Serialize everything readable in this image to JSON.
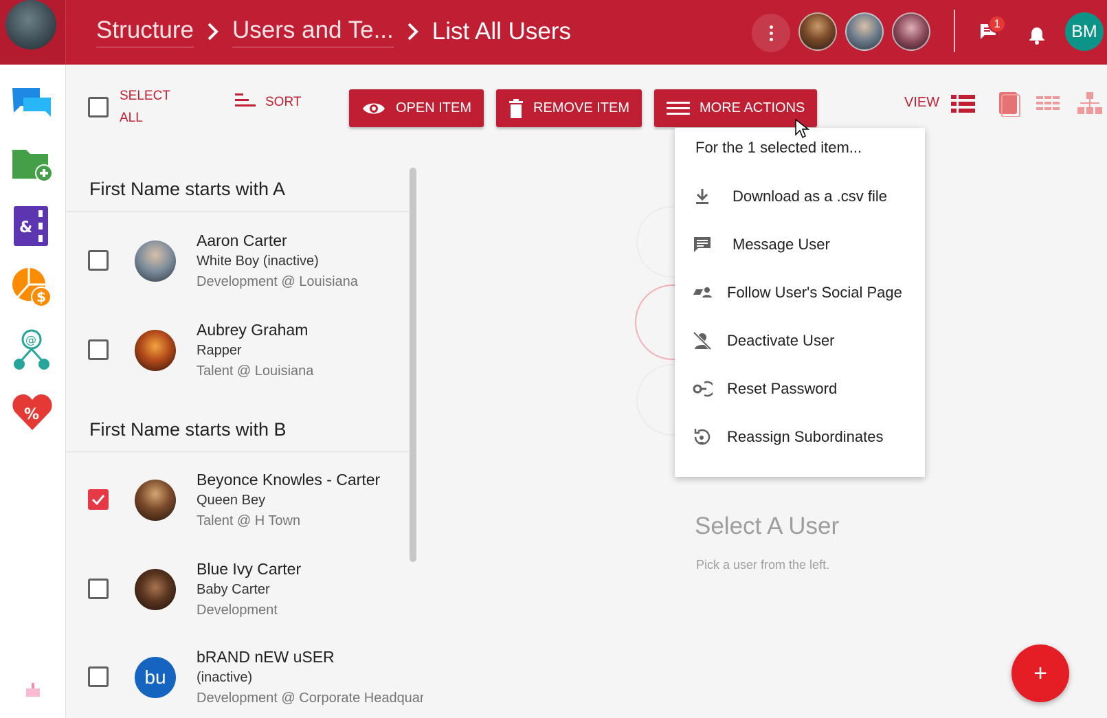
{
  "header": {
    "breadcrumbs": [
      {
        "label": "Structure"
      },
      {
        "label": "Users and Te..."
      }
    ],
    "current_page": "List All Users",
    "notification_count": "1",
    "user_initials": "BM"
  },
  "toolbar": {
    "select_all_label": "SELECT ALL",
    "sort_label": "SORT",
    "open_item_label": "OPEN ITEM",
    "remove_item_label": "REMOVE ITEM",
    "more_actions_label": "MORE ACTIONS",
    "view_label": "VIEW"
  },
  "list": {
    "groups": [
      {
        "header": "First Name starts with A"
      },
      {
        "header": "First Name starts with B"
      }
    ],
    "users": [
      {
        "name": "Aaron Carter",
        "title": "White Boy (inactive)",
        "dept": "Development @ Louisiana",
        "checked": false
      },
      {
        "name": "Aubrey Graham",
        "title": "Rapper",
        "dept": "Talent @ Louisiana",
        "checked": false
      },
      {
        "name": "Beyonce Knowles - Carter",
        "title": "Queen Bey",
        "dept": "Talent @ H Town",
        "checked": true
      },
      {
        "name": "Blue Ivy Carter",
        "title": "Baby Carter",
        "dept": "Development",
        "checked": false
      },
      {
        "name": "bRAND nEW uSER",
        "title": "(inactive)",
        "dept": "Development @ Corporate Headquarters",
        "checked": false,
        "initials": "bu"
      }
    ]
  },
  "menu": {
    "header": "For the 1 selected item...",
    "items": [
      {
        "label": "Download as a .csv file",
        "icon": "download-icon"
      },
      {
        "label": "Message User",
        "icon": "message-icon"
      },
      {
        "label": "Follow User's Social Page",
        "icon": "follow-icon"
      },
      {
        "label": "Deactivate User",
        "icon": "person-off-icon"
      },
      {
        "label": "Reset Password",
        "icon": "key-reset-icon"
      },
      {
        "label": "Reassign Subordinates",
        "icon": "reassign-icon"
      }
    ]
  },
  "detail": {
    "empty_title": "Select A User",
    "empty_subtitle": "Pick a user from the left."
  },
  "fab": {
    "label": "+"
  },
  "colors": {
    "primary": "#c01f33",
    "accent": "#e53945",
    "fab": "#e51e25",
    "avatar_teal": "#0d9488"
  }
}
